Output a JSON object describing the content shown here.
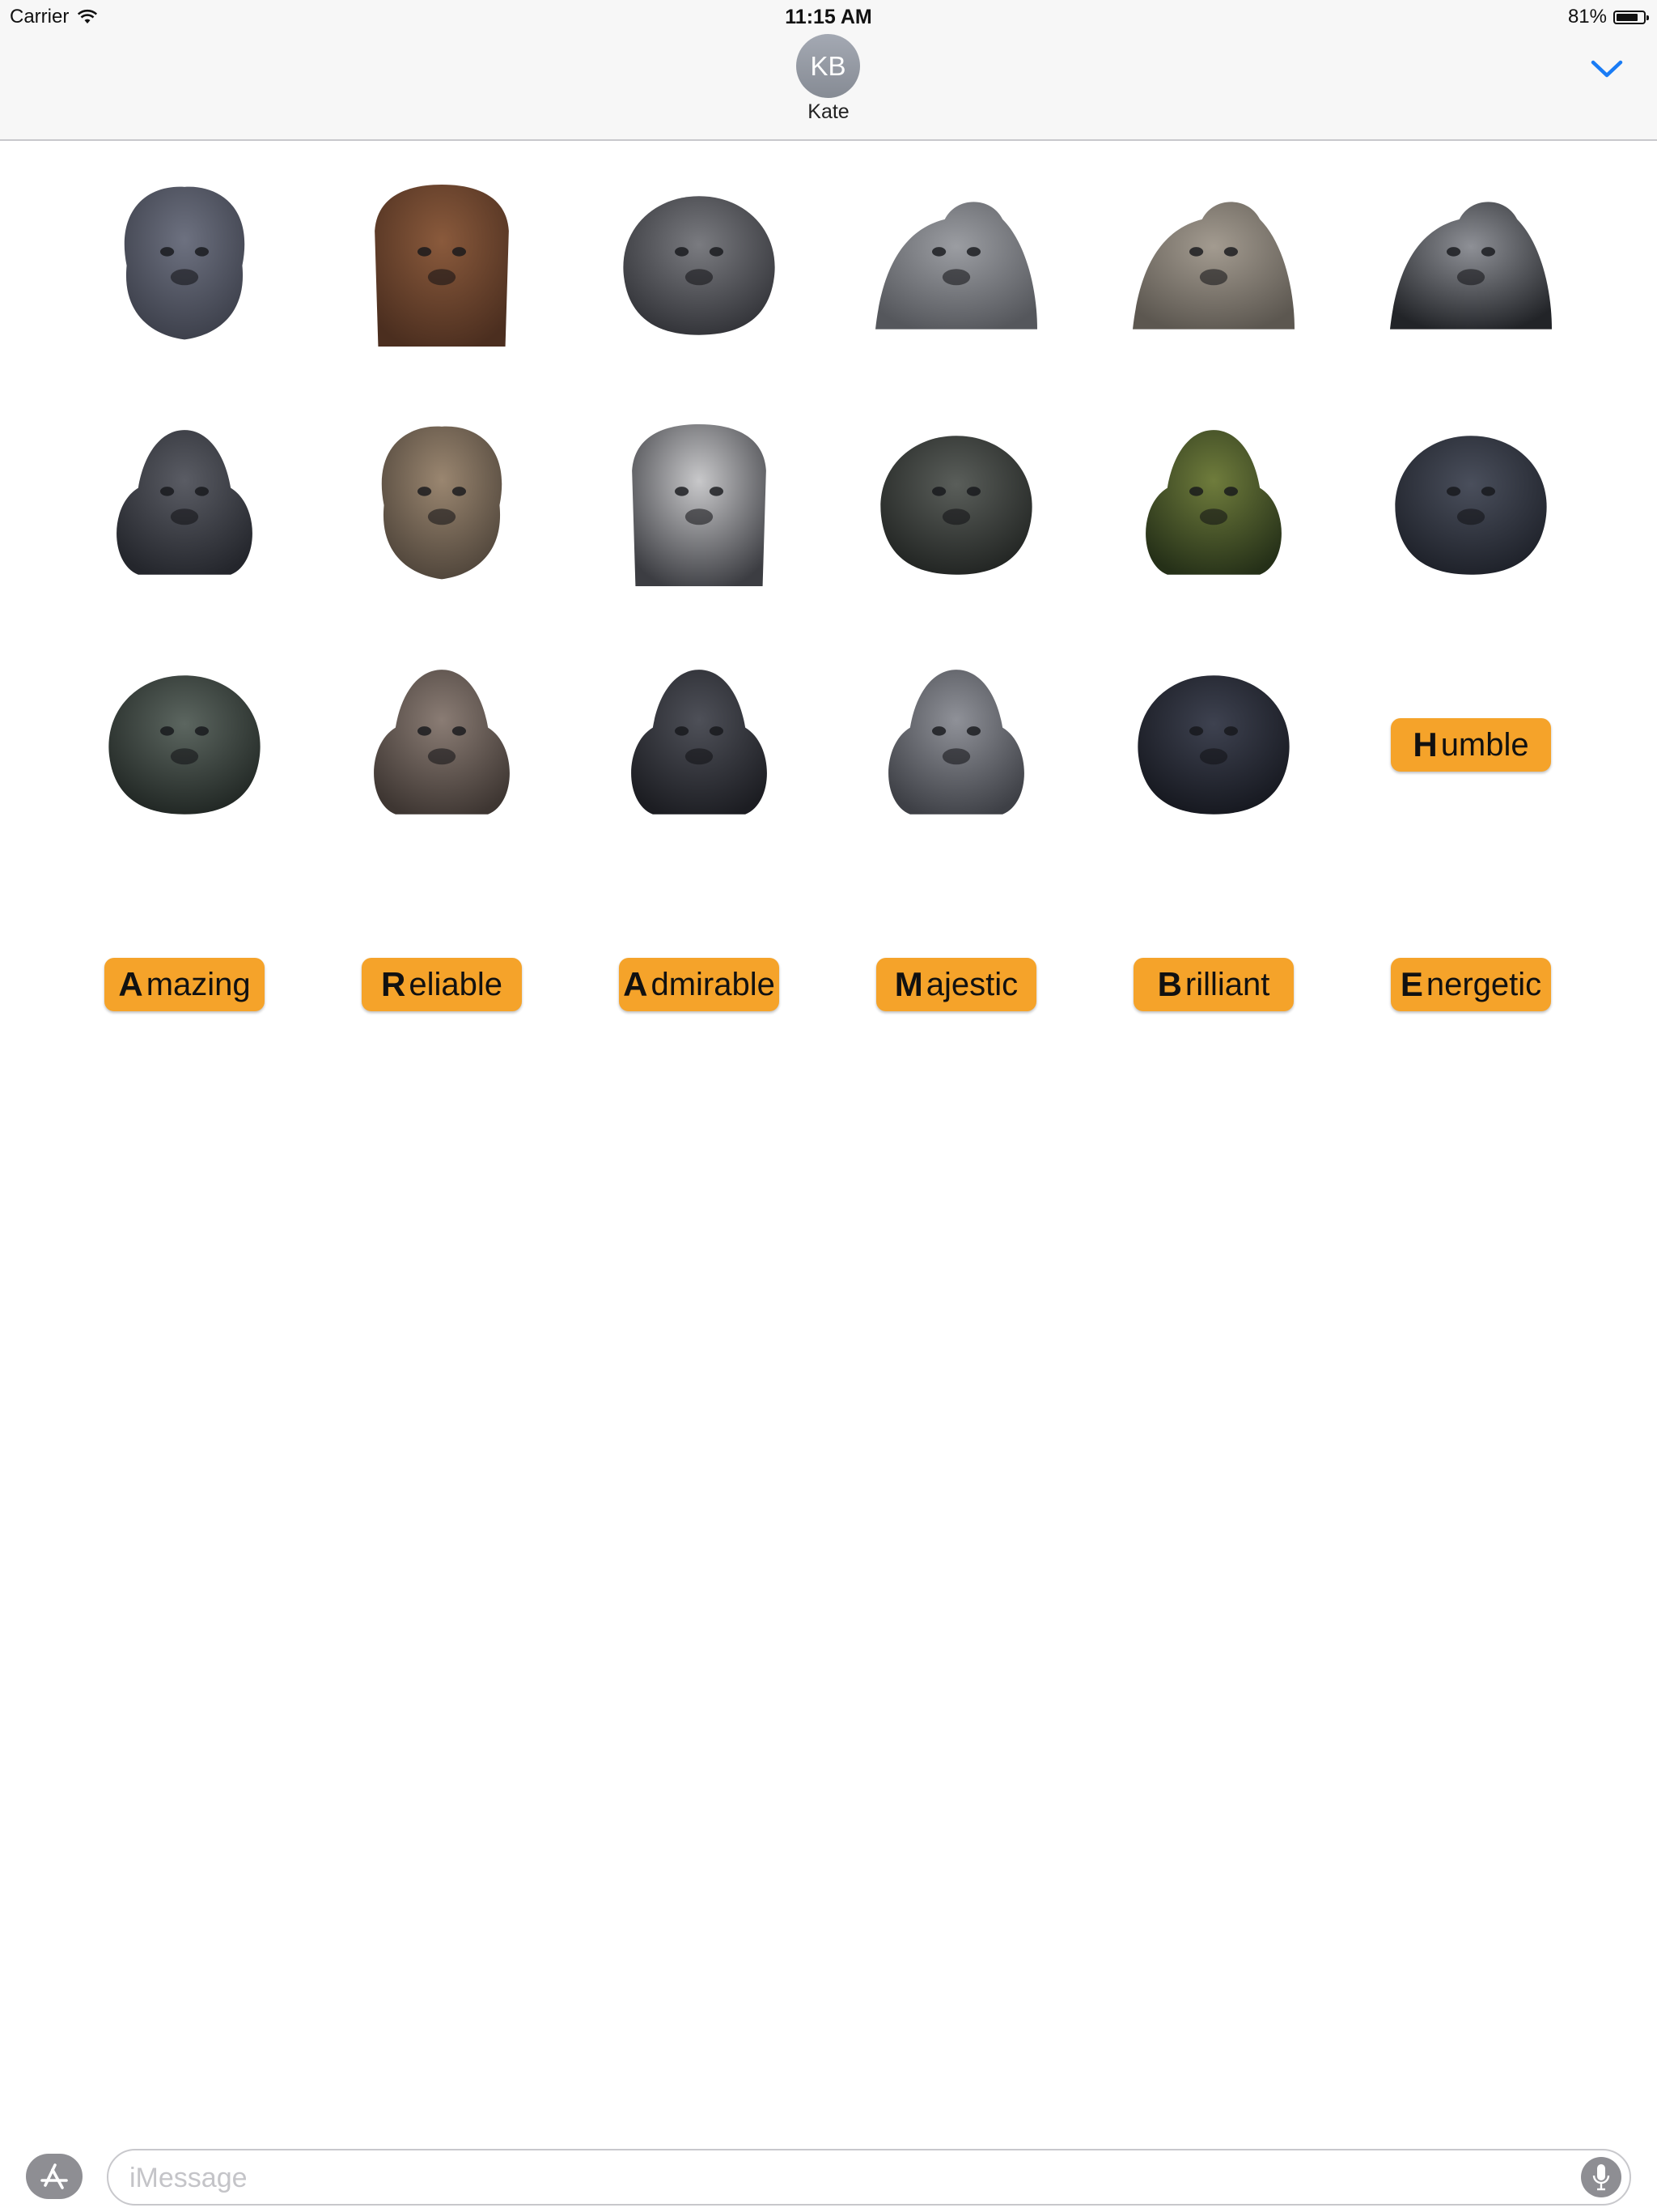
{
  "status_bar": {
    "carrier": "Carrier",
    "time": "11:15 AM",
    "battery": "81%",
    "battery_level": 0.81
  },
  "header": {
    "avatar_initials": "KB",
    "contact_name": "Kate"
  },
  "stickers": [
    {
      "kind": "image",
      "icon": "gorilla-face-front"
    },
    {
      "kind": "image",
      "icon": "gorilla-face-brown"
    },
    {
      "kind": "image",
      "icon": "gorilla-head-profile"
    },
    {
      "kind": "image",
      "icon": "gorilla-lying-back"
    },
    {
      "kind": "image",
      "icon": "gorilla-crouching"
    },
    {
      "kind": "image",
      "icon": "gorilla-walking-silverback"
    },
    {
      "kind": "image",
      "icon": "gorilla-sitting"
    },
    {
      "kind": "image",
      "icon": "gorilla-face-tilted"
    },
    {
      "kind": "image",
      "icon": "gorilla-standing-side"
    },
    {
      "kind": "image",
      "icon": "gorilla-roaring"
    },
    {
      "kind": "image",
      "icon": "gorilla-eating-green"
    },
    {
      "kind": "image",
      "icon": "gorilla-thinking"
    },
    {
      "kind": "image",
      "icon": "gorilla-lounging"
    },
    {
      "kind": "image",
      "icon": "gorilla-young-sitting"
    },
    {
      "kind": "image",
      "icon": "gorilla-seated-dark"
    },
    {
      "kind": "image",
      "icon": "gorilla-seated-grey"
    },
    {
      "kind": "image",
      "icon": "gorilla-resting-chin"
    },
    {
      "kind": "badge",
      "first": "H",
      "rest": "umble"
    },
    {
      "kind": "badge",
      "first": "A",
      "rest": "mazing"
    },
    {
      "kind": "badge",
      "first": "R",
      "rest": "eliable"
    },
    {
      "kind": "badge",
      "first": "A",
      "rest": "dmirable"
    },
    {
      "kind": "badge",
      "first": "M",
      "rest": "ajestic"
    },
    {
      "kind": "badge",
      "first": "B",
      "rest": "rilliant"
    },
    {
      "kind": "badge",
      "first": "E",
      "rest": "nergetic"
    }
  ],
  "input_bar": {
    "placeholder": "iMessage"
  },
  "colors": {
    "badge": "#f5a32a",
    "accent": "#1a7cf5"
  }
}
